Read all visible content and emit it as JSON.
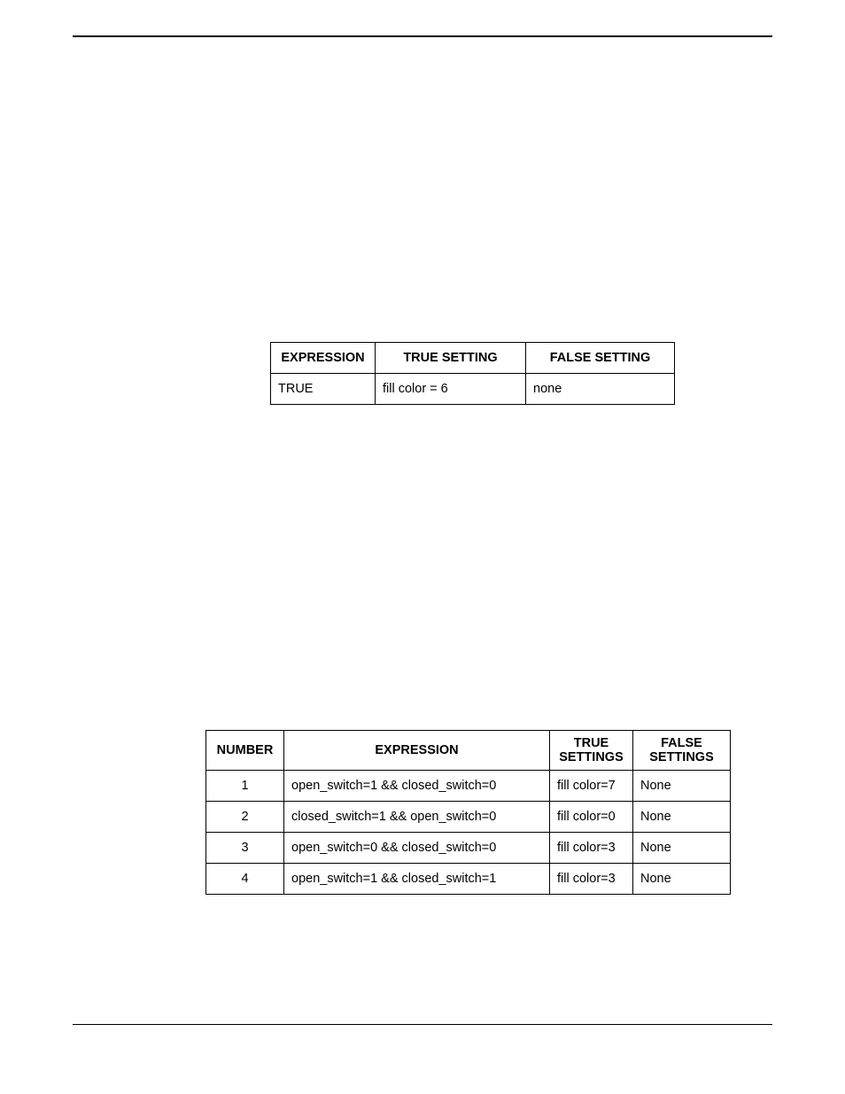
{
  "table1": {
    "headers": {
      "expression": "EXPRESSION",
      "true_setting": "TRUE SETTING",
      "false_setting": "FALSE SETTING"
    },
    "rows": [
      {
        "expression": "TRUE",
        "true_setting": "fill color = 6",
        "false_setting": "none"
      }
    ]
  },
  "table2": {
    "headers": {
      "number": "NUMBER",
      "expression": "EXPRESSION",
      "true_settings": "TRUE SETTINGS",
      "false_settings": "FALSE SETTINGS"
    },
    "rows": [
      {
        "number": "1",
        "expression": "open_switch=1    &&  closed_switch=0",
        "true_settings": "fill color=7",
        "false_settings": "None"
      },
      {
        "number": "2",
        "expression": "closed_switch=1  &&  open_switch=0",
        "true_settings": "fill color=0",
        "false_settings": "None"
      },
      {
        "number": "3",
        "expression": "open_switch=0    &&  closed_switch=0",
        "true_settings": "fill color=3",
        "false_settings": "None"
      },
      {
        "number": "4",
        "expression": "open_switch=1    &&  closed_switch=1",
        "true_settings": "fill color=3",
        "false_settings": "None"
      }
    ]
  }
}
